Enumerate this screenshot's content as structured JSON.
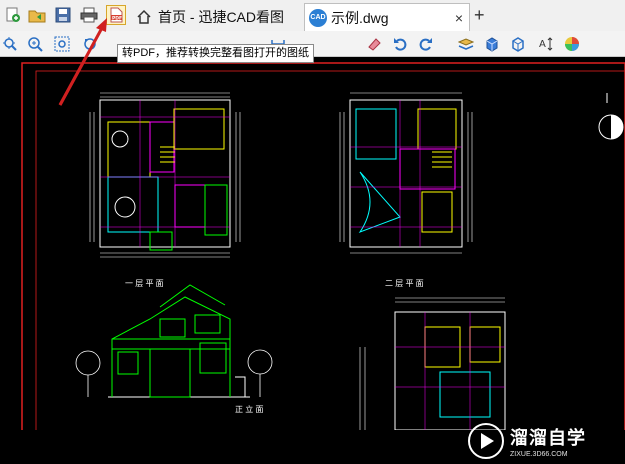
{
  "tabs": [
    {
      "label": "首页 - 迅捷CAD看图",
      "icon": "home-icon",
      "active": false
    },
    {
      "label": "示例.dwg",
      "icon": "cad-file-icon",
      "badge": "CAD",
      "active": true,
      "close": "×"
    }
  ],
  "new_tab": "+",
  "quick_icons": [
    "new-file-icon",
    "open-folder-icon",
    "save-icon",
    "print-icon",
    "pdf-icon"
  ],
  "toolbar_icons": [
    "zoom-extents-icon",
    "zoom-in-icon",
    "zoom-window-icon",
    "zoom-previous-icon",
    "measure-icon",
    "eraser-icon",
    "undo-icon",
    "redo-icon",
    "layers-icon",
    "3d-box-icon",
    "3d-cube-icon",
    "text-size-icon",
    "color-wheel-icon"
  ],
  "tooltip": "转PDF，推荐转换完整看图打开的图纸",
  "cad_labels": {
    "floor1": "一 层 平 面",
    "floor2": "二 层 平 面",
    "elevation": "正 立 面"
  },
  "watermark": {
    "title": "溜溜自学",
    "url": "ZIXUE.3D66.COM"
  },
  "colors": {
    "tab_bg": "#f0f0f0",
    "canvas": "#000000",
    "arrow": "#d02020",
    "watermark_bg": "#2a3a55"
  }
}
